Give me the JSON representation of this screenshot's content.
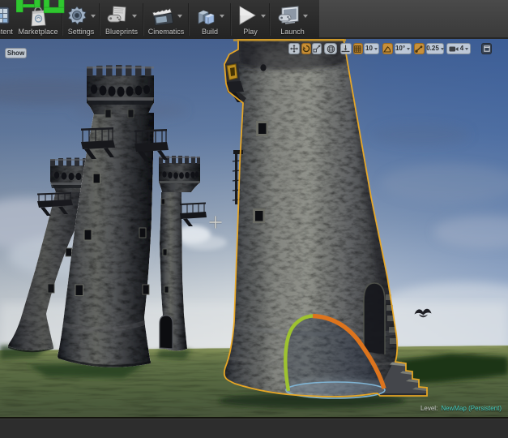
{
  "watermark": {
    "text": "PU",
    "color": "#2cbd2e"
  },
  "toolbar": {
    "buttons": [
      {
        "id": "content",
        "label": "Content",
        "has_dropdown": false
      },
      {
        "id": "marketplace",
        "label": "Marketplace",
        "has_dropdown": false
      },
      {
        "id": "settings",
        "label": "Settings",
        "has_dropdown": true
      },
      {
        "id": "blueprints",
        "label": "Blueprints",
        "has_dropdown": true
      },
      {
        "id": "cinematics",
        "label": "Cinematics",
        "has_dropdown": true
      },
      {
        "id": "build",
        "label": "Build",
        "has_dropdown": true
      },
      {
        "id": "play",
        "label": "Play",
        "has_dropdown": true
      },
      {
        "id": "launch",
        "label": "Launch",
        "has_dropdown": true
      }
    ]
  },
  "viewport": {
    "show_button_label": "Show",
    "snap_toolbar": {
      "active_transform_tool": "rotate",
      "grid_snap_enabled": true,
      "grid_snap_value": "10",
      "rotation_snap_enabled": true,
      "rotation_snap_value": "10°",
      "scale_snap_enabled": true,
      "scale_snap_value": "0.25",
      "camera_speed_value": "4"
    },
    "status": {
      "level_label": "Level:",
      "level_value": "NewMap (Persistent)"
    },
    "selection": {
      "selected_object": "tower",
      "outline_color": "#edaa24",
      "arc_green_color": "#9ec32f",
      "arc_orange_color": "#dd741d",
      "ellipse_blue_color": "#7fb3d3"
    }
  },
  "colors": {
    "toolbar_bg": "#2c2c2c",
    "viewport_sky_top": "#47618e",
    "viewport_sky_horizon": "#e0e3e4",
    "grass": "#5e7044",
    "level_value_teal": "#45cabe",
    "snap_active_orange": "#d09235"
  }
}
